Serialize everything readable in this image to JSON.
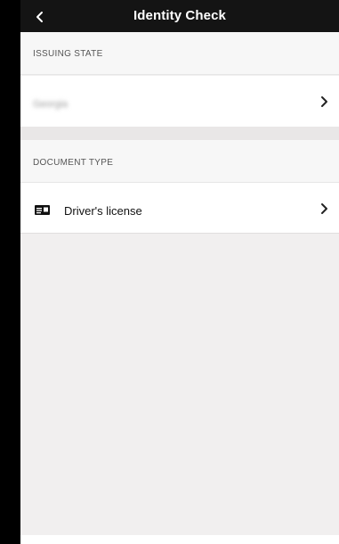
{
  "header": {
    "title": "Identity Check",
    "back_icon": "chevron-left-icon"
  },
  "issuing_state": {
    "section_label": "ISSUING STATE",
    "value": "Georgia",
    "chevron_icon": "chevron-right-icon"
  },
  "document_type": {
    "section_label": "DOCUMENT TYPE",
    "value": "Driver's license",
    "icon": "id-card-icon",
    "chevron_icon": "chevron-right-icon"
  },
  "colors": {
    "nav_background": "#141414",
    "screen_background": "#f1efef",
    "row_background": "#ffffff"
  }
}
